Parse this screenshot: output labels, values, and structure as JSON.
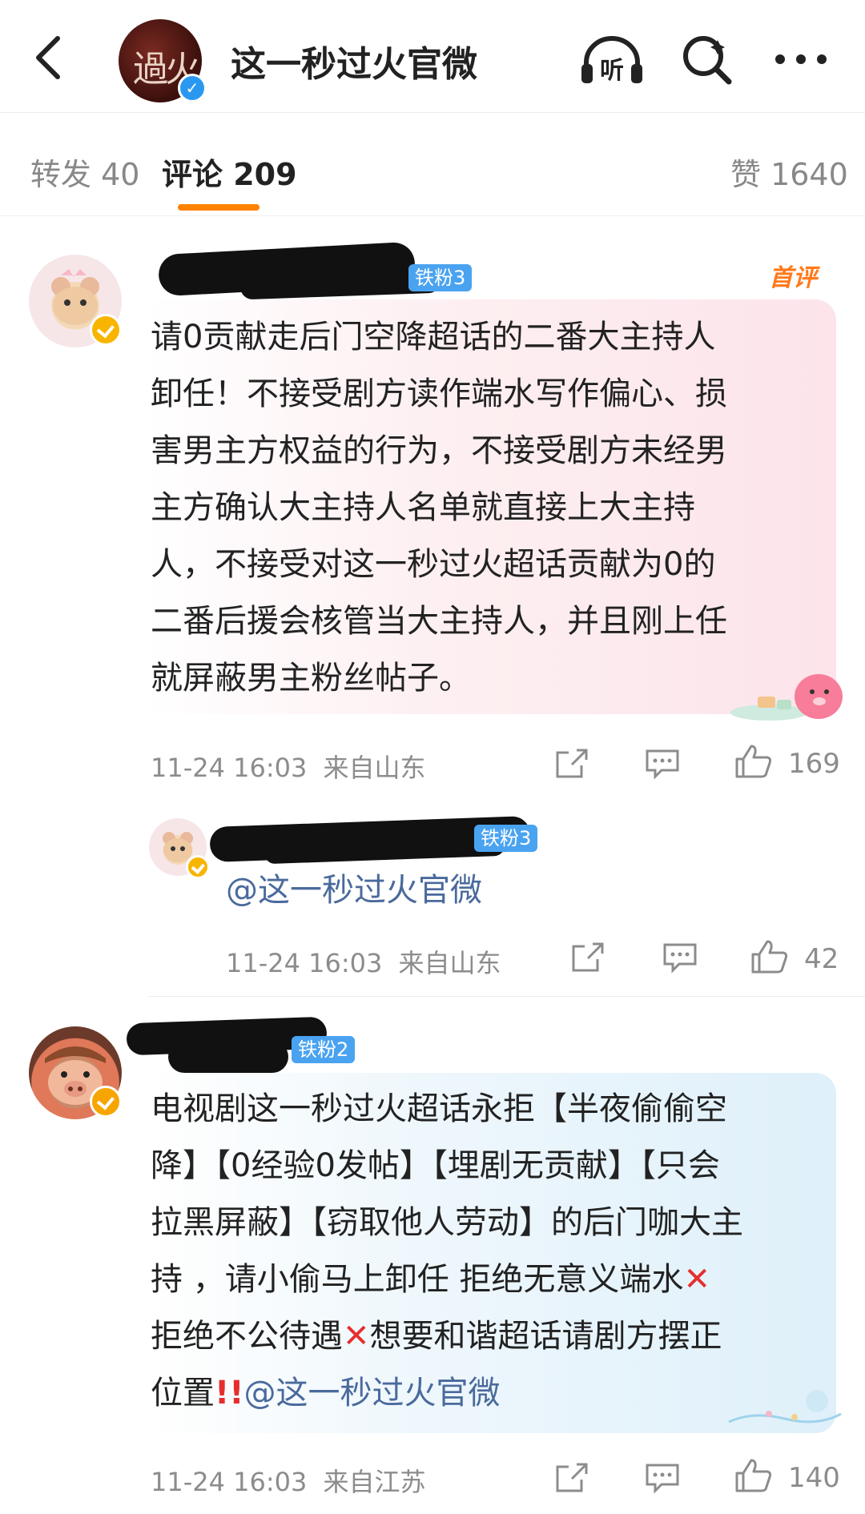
{
  "header": {
    "title": "这一秒过火官微",
    "avatar_text": "過火"
  },
  "tabs": {
    "repost": "转发 40",
    "comments": "评论 209",
    "likes": "赞 1640"
  },
  "comments": [
    {
      "badge": "铁粉3",
      "first_label": "首评",
      "text": "请0贡献走后门空降超话的二番大主持人卸任！不接受剧方读作端水写作偏心、损害男主方权益的行为，不接受剧方未经男主方确认大主持人名单就直接上大主持人，不接受对这一秒过火超话贡献为0的二番后援会核管当大主持人，并且刚上任就屏蔽男主粉丝帖子。",
      "lines": [
        "请0贡献走后门空降超话的二番大主持人",
        "卸任！不接受剧方读作端水写作偏心、损",
        "害男主方权益的行为，不接受剧方未经男",
        "主方确认大主持人名单就直接上大主持",
        "人，不接受对这一秒过火超话贡献为0的",
        "二番后援会核管当大主持人，并且刚上任",
        "就屏蔽男主粉丝帖子。"
      ],
      "time": "11-24 16:03",
      "location": "来自山东",
      "likes": "169"
    },
    {
      "badge": "铁粉3",
      "text": "@这一秒过火官微",
      "time": "11-24 16:03",
      "location": "来自山东",
      "likes": "42"
    },
    {
      "badge": "铁粉2",
      "lines": [
        "电视剧这一秒过火超话永拒【半夜偷偷空",
        "降】【0经验0发帖】【埋剧无贡献】【只会",
        "拉黑屏蔽】【窃取他人劳动】的后门咖大主",
        "持 ，请小偷马上卸任 拒绝无意义端水",
        "拒绝不公待遇",
        "想要和谐超话请剧方摆正",
        "位置",
        "@这一秒过火官微"
      ],
      "time": "11-24 16:03",
      "location": "来自江苏",
      "likes": "140"
    }
  ],
  "colors": {
    "accent": "#ff8200",
    "mention": "#4a6a9c",
    "bubble_pink": "#fdebef",
    "bubble_blue": "#e6f3fb"
  }
}
